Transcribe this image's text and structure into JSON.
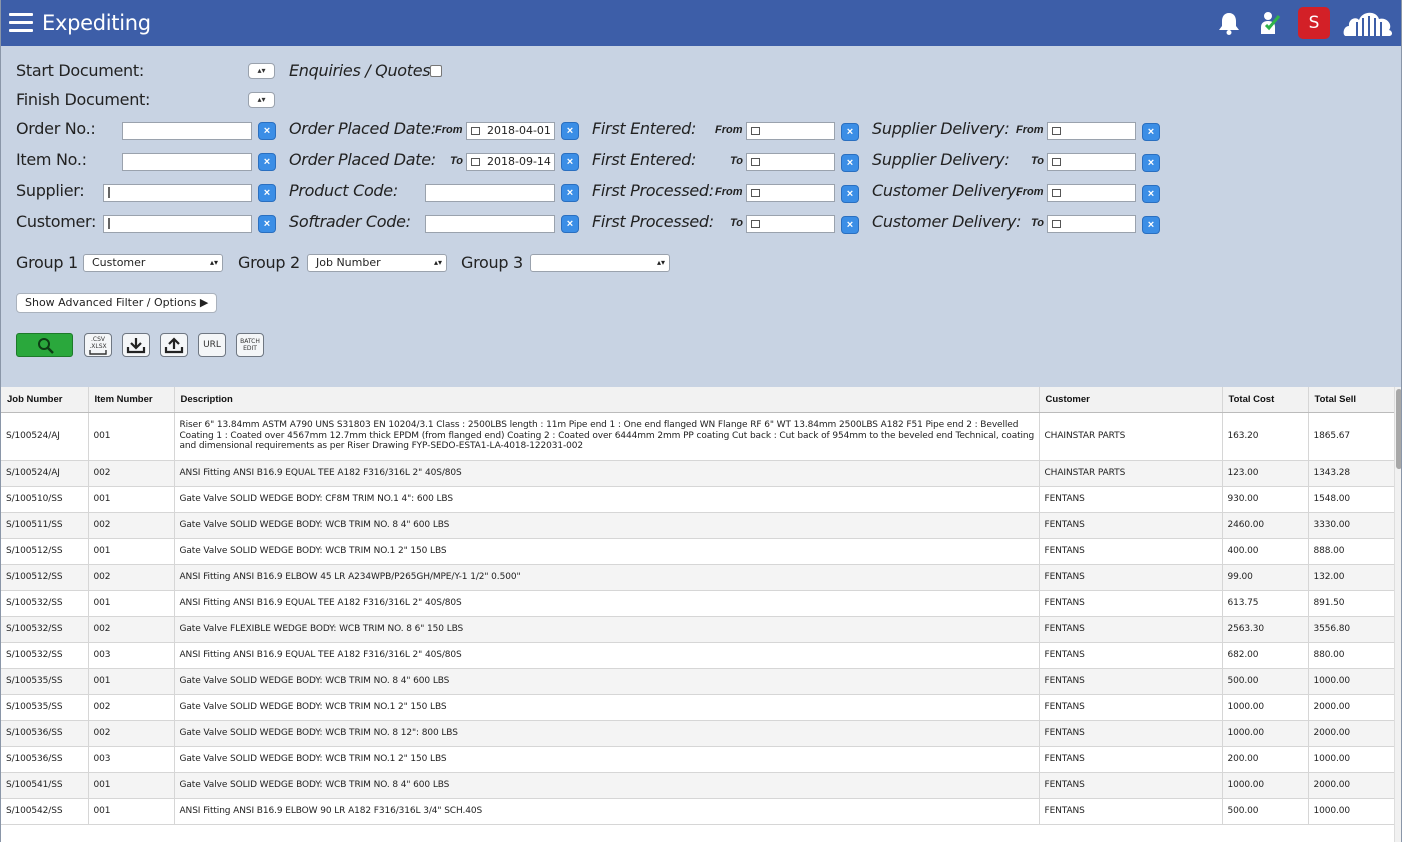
{
  "app": {
    "title": "Expediting",
    "avatar_letter": "S"
  },
  "icons": {
    "menu": "hamburger-icon",
    "notify": "bell-icon",
    "user": "user-check-icon",
    "cloud": "cloud-icon",
    "search": "search-icon"
  },
  "filters": {
    "start_document": "Start Document:",
    "finish_document": "Finish Document:",
    "enquiries_quotes": "Enquiries / Quotes",
    "order_no": "Order No.:",
    "item_no": "Item No.:",
    "supplier": "Supplier:",
    "customer": "Customer:",
    "order_placed_date": "Order Placed Date:",
    "product_code": "Product Code:",
    "softrader_code": "Softrader Code:",
    "first_entered": "First Entered:",
    "first_processed": "First Processed:",
    "supplier_delivery": "Supplier Delivery:",
    "customer_delivery": "Customer Delivery:",
    "from": "From",
    "to": "To",
    "order_from_value": "2018-04-01",
    "order_to_value": "2018-09-14",
    "clear": "×"
  },
  "grouping": {
    "group1_label": "Group 1",
    "group1_value": "Customer",
    "group2_label": "Group 2",
    "group2_value": "Job Number",
    "group3_label": "Group 3",
    "group3_value": ""
  },
  "toolbar": {
    "advanced_label": "Show Advanced Filter / Options ▶",
    "csv": ".CSV",
    "xlsx": ".XLSX",
    "url": "URL",
    "batch": "BATCH",
    "edit": "EDIT"
  },
  "table": {
    "headers": [
      "Job Number",
      "Item Number",
      "Description",
      "Customer",
      "Total Cost",
      "Total Sell"
    ],
    "rows": [
      [
        "S/100524/AJ",
        "001",
        "Riser 6\" 13.84mm ASTM A790 UNS S31803 EN 10204/3.1 Class : 2500LBS length : 11m Pipe end 1 : One end flanged WN Flange RF 6\" WT 13.84mm 2500LBS A182 F51 Pipe end 2 : Bevelled Coating 1 : Coated over 4567mm 12.7mm thick EPDM (from flanged end) Coating 2 : Coated over 6444mm 2mm PP coating Cut back : Cut back of 954mm to the beveled end Technical, coating and dimensional requirements as per Riser Drawing FYP-SEDO-ESTA1-LA-4018-122031-002",
        "CHAINSTAR PARTS",
        "163.20",
        "1865.67"
      ],
      [
        "S/100524/AJ",
        "002",
        "ANSI Fitting ANSI B16.9 EQUAL TEE A182 F316/316L 2\" 40S/80S",
        "CHAINSTAR PARTS",
        "123.00",
        "1343.28"
      ],
      [
        "S/100510/SS",
        "001",
        "Gate Valve SOLID WEDGE BODY: CF8M TRIM NO.1 4\": 600 LBS",
        "FENTANS",
        "930.00",
        "1548.00"
      ],
      [
        "S/100511/SS",
        "002",
        "Gate Valve SOLID WEDGE BODY: WCB TRIM NO. 8 4\" 600 LBS",
        "FENTANS",
        "2460.00",
        "3330.00"
      ],
      [
        "S/100512/SS",
        "001",
        "Gate Valve SOLID WEDGE BODY: WCB TRIM NO.1 2\" 150 LBS",
        "FENTANS",
        "400.00",
        "888.00"
      ],
      [
        "S/100512/SS",
        "002",
        "ANSI Fitting ANSI B16.9 ELBOW 45 LR A234WPB/P265GH/MPE/Y-1 1/2\" 0.500\"",
        "FENTANS",
        "99.00",
        "132.00"
      ],
      [
        "S/100532/SS",
        "001",
        "ANSI Fitting ANSI B16.9 EQUAL TEE A182 F316/316L 2\" 40S/80S",
        "FENTANS",
        "613.75",
        "891.50"
      ],
      [
        "S/100532/SS",
        "002",
        "Gate Valve FLEXIBLE WEDGE BODY: WCB TRIM NO. 8 6\" 150 LBS",
        "FENTANS",
        "2563.30",
        "3556.80"
      ],
      [
        "S/100532/SS",
        "003",
        "ANSI Fitting ANSI B16.9 EQUAL TEE A182 F316/316L 2\" 40S/80S",
        "FENTANS",
        "682.00",
        "880.00"
      ],
      [
        "S/100535/SS",
        "001",
        "Gate Valve SOLID WEDGE BODY: WCB TRIM NO. 8 4\" 600 LBS",
        "FENTANS",
        "500.00",
        "1000.00"
      ],
      [
        "S/100535/SS",
        "002",
        "Gate Valve SOLID WEDGE BODY: WCB TRIM NO.1 2\" 150 LBS",
        "FENTANS",
        "1000.00",
        "2000.00"
      ],
      [
        "S/100536/SS",
        "002",
        "Gate Valve SOLID WEDGE BODY: WCB TRIM NO. 8 12\": 800 LBS",
        "FENTANS",
        "1000.00",
        "2000.00"
      ],
      [
        "S/100536/SS",
        "003",
        "Gate Valve SOLID WEDGE BODY: WCB TRIM NO.1 2\" 150 LBS",
        "FENTANS",
        "200.00",
        "1000.00"
      ],
      [
        "S/100541/SS",
        "001",
        "Gate Valve SOLID WEDGE BODY: WCB TRIM NO. 8 4\" 600 LBS",
        "FENTANS",
        "1000.00",
        "2000.00"
      ],
      [
        "S/100542/SS",
        "001",
        "ANSI Fitting ANSI B16.9 ELBOW 90 LR A182 F316/316L 3/4\" SCH.40S",
        "FENTANS",
        "500.00",
        "1000.00"
      ]
    ]
  }
}
